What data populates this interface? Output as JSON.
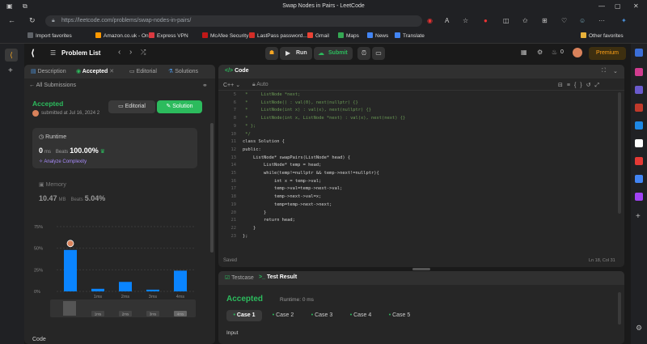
{
  "browser": {
    "window_title": "Swap Nodes in Pairs - LeetCode",
    "url": "https://leetcode.com/problems/swap-nodes-in-pairs/",
    "favorites": [
      {
        "label": "Import favorites",
        "color": "#5f6368"
      },
      {
        "label": "Amazon.co.uk - On...",
        "color": "#ff9900"
      },
      {
        "label": "Express VPN",
        "color": "#da3940"
      },
      {
        "label": "McAfee Security",
        "color": "#c01818"
      },
      {
        "label": "LastPass password...",
        "color": "#d32d27"
      },
      {
        "label": "Gmail",
        "color": "#ea4335"
      },
      {
        "label": "Maps",
        "color": "#34a853"
      },
      {
        "label": "News",
        "color": "#4285f4"
      },
      {
        "label": "Translate",
        "color": "#4285f4"
      }
    ],
    "other_favorites": "Other favorites"
  },
  "app": {
    "problem_list": "Problem List",
    "run": "Run",
    "submit": "Submit",
    "streak_count": "0",
    "premium": "Premium"
  },
  "left": {
    "tabs": [
      "Description",
      "Accepted",
      "Editorial",
      "Solutions"
    ],
    "all_submissions": "All Submissions",
    "status": "Accepted",
    "submitted": "submitted at Jul 16, 2024 2",
    "editorial_btn": "Editorial",
    "solution_btn": "Solution",
    "runtime_label": "Runtime",
    "runtime_value": "0",
    "runtime_unit": "ms",
    "beats_label": "Beats",
    "runtime_beats": "100.00%",
    "analyze": "Analyze Complexity",
    "memory_label": "Memory",
    "memory_value": "10.47",
    "memory_unit": "MB",
    "memory_beats": "5.04%",
    "code_label": "Code"
  },
  "chart_data": {
    "type": "bar",
    "y_ticks": [
      "75%",
      "50%",
      "25%",
      "0%"
    ],
    "ylim": [
      0,
      75
    ],
    "categories": [
      "0ms",
      "1ms",
      "2ms",
      "3ms",
      "4ms"
    ],
    "x_tick_labels": [
      "",
      "1ms",
      "2ms",
      "3ms",
      "4ms"
    ],
    "values": [
      48,
      3,
      11,
      2,
      24
    ],
    "mini_labels": [
      "1ms",
      "2ms",
      "3ms",
      "4ms"
    ],
    "bar_color": "#0a84ff"
  },
  "code_panel": {
    "title": "Code",
    "language": "C++",
    "mode": "Auto",
    "saved": "Saved",
    "cursor": "Ln 18, Col 31",
    "lines": [
      {
        "n": "5",
        "text": " *     ListNode *next;",
        "cls": "cm"
      },
      {
        "n": "6",
        "text": " *     ListNode() : val(0), next(nullptr) {}",
        "cls": "cm"
      },
      {
        "n": "7",
        "text": " *     ListNode(int x) : val(x), next(nullptr) {}",
        "cls": "cm"
      },
      {
        "n": "8",
        "text": " *     ListNode(int x, ListNode *next) : val(x), next(next) {}",
        "cls": "cm"
      },
      {
        "n": "9",
        "text": " * };",
        "cls": "cm"
      },
      {
        "n": "10",
        "text": " */",
        "cls": "cm"
      },
      {
        "n": "11",
        "text": "class Solution {",
        "cls": ""
      },
      {
        "n": "12",
        "text": "public:",
        "cls": ""
      },
      {
        "n": "13",
        "text": "    ListNode* swapPairs(ListNode* head) {",
        "cls": ""
      },
      {
        "n": "14",
        "text": "        ListNode* temp = head;",
        "cls": ""
      },
      {
        "n": "15",
        "text": "        while(temp!=nullptr && temp->next!=nullptr){",
        "cls": ""
      },
      {
        "n": "16",
        "text": "            int x = temp->val;",
        "cls": ""
      },
      {
        "n": "17",
        "text": "            temp->val=temp->next->val;",
        "cls": ""
      },
      {
        "n": "18",
        "text": "            temp->next->val=x;",
        "cls": ""
      },
      {
        "n": "19",
        "text": "            temp=temp->next->next;",
        "cls": ""
      },
      {
        "n": "20",
        "text": "        }",
        "cls": ""
      },
      {
        "n": "21",
        "text": "        return head;",
        "cls": ""
      },
      {
        "n": "22",
        "text": "    }",
        "cls": ""
      },
      {
        "n": "23",
        "text": "};",
        "cls": ""
      }
    ]
  },
  "test_panel": {
    "tabs": [
      "Testcase",
      "Test Result"
    ],
    "status": "Accepted",
    "runtime": "Runtime: 0 ms",
    "cases": [
      "Case 1",
      "Case 2",
      "Case 3",
      "Case 4",
      "Case 5"
    ],
    "input_label": "Input"
  }
}
